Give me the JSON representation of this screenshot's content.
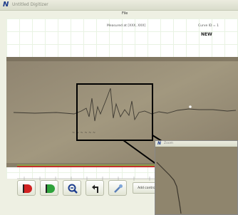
{
  "window": {
    "title": "Untitled Digitizer",
    "icon": "N"
  },
  "menu": {
    "file": "File"
  },
  "info": {
    "title": "Measured at [XXX, XXX]",
    "curve_label": "Curve ID = 1",
    "value": "NEW"
  },
  "toolbar": {
    "buttons": [
      {
        "name": "start-red-marker-button",
        "icon": "red-marker-icon"
      },
      {
        "name": "start-green-marker-button",
        "icon": "green-marker-icon"
      },
      {
        "name": "zoom-button",
        "icon": "magnifier-icon"
      },
      {
        "name": "undo-button",
        "icon": "return-arrow-icon"
      },
      {
        "name": "pick-color-button",
        "icon": "eyedropper-icon"
      }
    ],
    "add_label": "Add control point"
  },
  "zoom_window": {
    "title": "Zoom",
    "icon": "N"
  },
  "colors": {
    "title_bar": "#d9dccb",
    "grid": "#e9f3e3",
    "red_line": "#c4312c",
    "green_line": "#8aa04a",
    "selection_box": "#000000"
  }
}
